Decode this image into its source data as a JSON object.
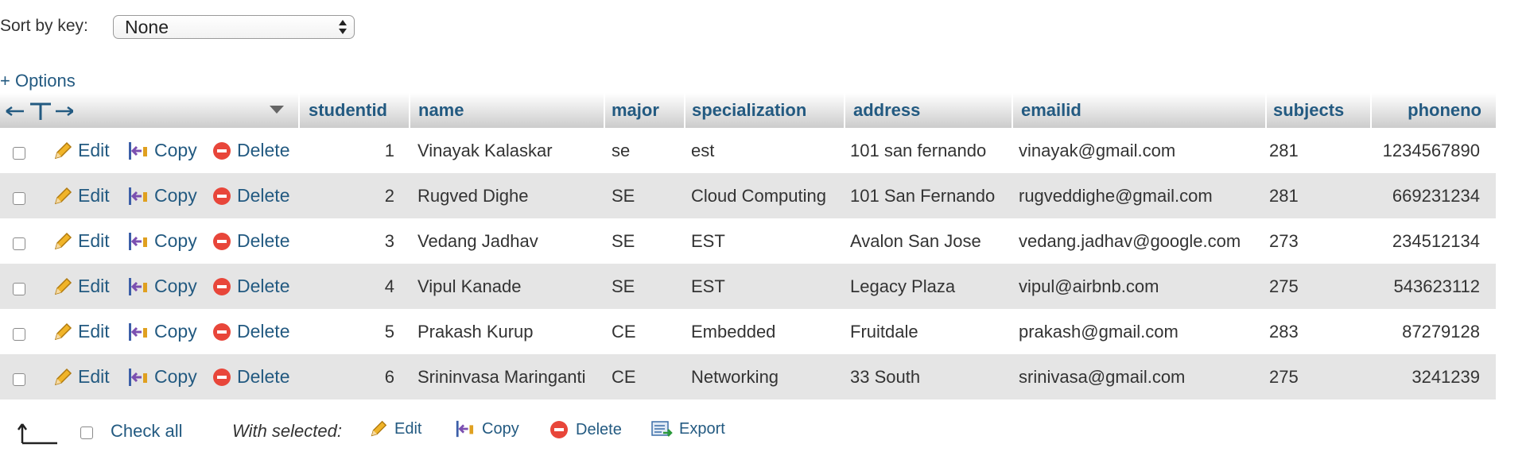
{
  "sort": {
    "label": "Sort by key:",
    "selected": "None"
  },
  "options_link": "+ Options",
  "columns": [
    "studentid",
    "name",
    "major",
    "specialization",
    "address",
    "emailid",
    "subjects",
    "phoneno"
  ],
  "row_actions": {
    "edit": "Edit",
    "copy": "Copy",
    "delete": "Delete"
  },
  "rows": [
    {
      "studentid": "1",
      "name": "Vinayak Kalaskar",
      "major": "se",
      "specialization": "est",
      "address": "101 san fernando",
      "emailid": "vinayak@gmail.com",
      "subjects": "281",
      "phoneno": "1234567890"
    },
    {
      "studentid": "2",
      "name": "Rugved Dighe",
      "major": "SE",
      "specialization": "Cloud Computing",
      "address": "101 San Fernando",
      "emailid": "rugveddighe@gmail.com",
      "subjects": "281",
      "phoneno": "669231234"
    },
    {
      "studentid": "3",
      "name": "Vedang Jadhav",
      "major": "SE",
      "specialization": "EST",
      "address": "Avalon San Jose",
      "emailid": "vedang.jadhav@google.com",
      "subjects": "273",
      "phoneno": "234512134"
    },
    {
      "studentid": "4",
      "name": "Vipul Kanade",
      "major": "SE",
      "specialization": "EST",
      "address": "Legacy Plaza",
      "emailid": "vipul@airbnb.com",
      "subjects": "275",
      "phoneno": "543623112"
    },
    {
      "studentid": "5",
      "name": "Prakash Kurup",
      "major": "CE",
      "specialization": "Embedded",
      "address": "Fruitdale",
      "emailid": "prakash@gmail.com",
      "subjects": "283",
      "phoneno": "87279128"
    },
    {
      "studentid": "6",
      "name": "Srininvasa Maringanti",
      "major": "CE",
      "specialization": "Networking",
      "address": "33 South",
      "emailid": "srinivasa@gmail.com",
      "subjects": "275",
      "phoneno": "3241239"
    }
  ],
  "footer": {
    "check_all": "Check all",
    "with_selected": "With selected:",
    "edit": "Edit",
    "copy": "Copy",
    "delete": "Delete",
    "export": "Export"
  },
  "colors": {
    "link": "#235a81",
    "row_alt": "#e5e5e5",
    "delete_icon": "#e8463a"
  }
}
